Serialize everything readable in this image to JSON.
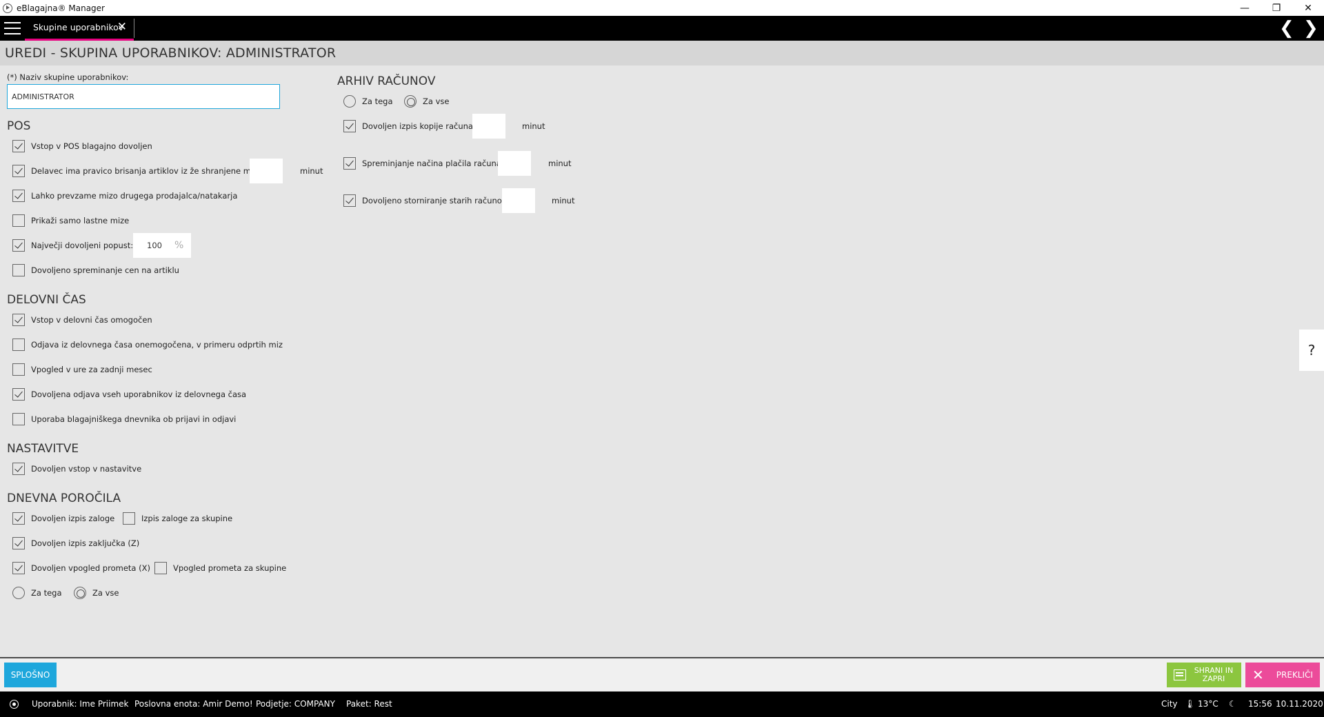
{
  "window": {
    "title": "eBlagajna® Manager",
    "minimize": "—",
    "maximize": "❐",
    "close": "✕"
  },
  "tabs": [
    {
      "label": "Skupine uporabnikov",
      "close": "✕"
    }
  ],
  "nav": {
    "prev": "❮",
    "next": "❯"
  },
  "page": {
    "title": "UREDI - SKUPINA UPORABNIKOV: ADMINISTRATOR"
  },
  "group_name": {
    "label": "(*) Naziv skupine uporabnikov:",
    "value": "ADMINISTRATOR"
  },
  "pos": {
    "heading": "POS",
    "items": [
      {
        "label": "Vstop v POS blagajno dovoljen",
        "checked": true
      },
      {
        "label": "Delavec ima pravico brisanja artiklov iz že shranjene mize",
        "checked": true
      },
      {
        "label": "Lahko prevzame mizo drugega prodajalca/natakarja",
        "checked": true
      },
      {
        "label": "Prikaži samo lastne mize",
        "checked": false
      },
      {
        "label": "Največji dovoljeni popust:",
        "checked": true
      },
      {
        "label": "Dovoljeno spreminanje cen na artiklu",
        "checked": false
      }
    ],
    "delete_unit": "minut",
    "discount_value": "100",
    "discount_unit": "%"
  },
  "work_time": {
    "heading": "DELOVNI ČAS",
    "items": [
      {
        "label": "Vstop v delovni čas omogočen",
        "checked": true
      },
      {
        "label": "Odjava iz delovnega časa onemogočena, v primeru odprtih miz",
        "checked": false
      },
      {
        "label": "Vpogled v ure za zadnji mesec",
        "checked": false
      },
      {
        "label": "Dovoljena odjava vseh uporabnikov iz delovnega časa",
        "checked": true
      },
      {
        "label": "Uporaba blagajniškega dnevnika ob prijavi in odjavi",
        "checked": false
      }
    ]
  },
  "settings": {
    "heading": "NASTAVITVE",
    "items": [
      {
        "label": "Dovoljen vstop v nastavitve",
        "checked": true
      }
    ]
  },
  "daily_reports": {
    "heading": "DNEVNA POROČILA",
    "items": [
      {
        "label": "Dovoljen izpis zaloge",
        "checked": true
      },
      {
        "label": "Izpis zaloge za skupine",
        "checked": false
      },
      {
        "label": "Dovoljen izpis zaključka (Z)",
        "checked": true
      },
      {
        "label": "Dovoljen vpogled prometa (X)",
        "checked": true
      },
      {
        "label": "Vpogled prometa za skupine",
        "checked": false
      }
    ],
    "radios": [
      {
        "label": "Za tega",
        "selected": false
      },
      {
        "label": "Za vse",
        "selected": true
      }
    ]
  },
  "archive": {
    "heading": "ARHIV RAČUNOV",
    "radios": [
      {
        "label": "Za tega",
        "selected": false
      },
      {
        "label": "Za vse",
        "selected": true
      }
    ],
    "items": [
      {
        "label": "Dovoljen izpis kopije računa",
        "checked": true,
        "unit": "minut"
      },
      {
        "label": "Spreminjanje načina plačila računa",
        "checked": true,
        "unit": "minut"
      },
      {
        "label": "Dovoljeno storniranje starih računov",
        "checked": true,
        "unit": "minut"
      }
    ]
  },
  "help": {
    "label": "?"
  },
  "toolbar": {
    "general": "SPLOŠNO",
    "save": "SHRANI IN ZAPRI",
    "cancel": "PREKLIČI",
    "cancel_icon": "✕"
  },
  "status": {
    "user": "Uporabnik: Ime Priimek",
    "unit": "Poslovna enota: Amir Demo!",
    "company": "Podjetje: COMPANY",
    "package": "Paket: Rest",
    "city": "City",
    "temperature": "🌡 13°C",
    "moon": "☾",
    "time": "15:56",
    "date": "10.11.2020"
  },
  "colors": {
    "accent": "#1ea7dc",
    "save": "#8cc63f",
    "cancel": "#ec4b9a",
    "tab_underline": "#e6007e"
  }
}
